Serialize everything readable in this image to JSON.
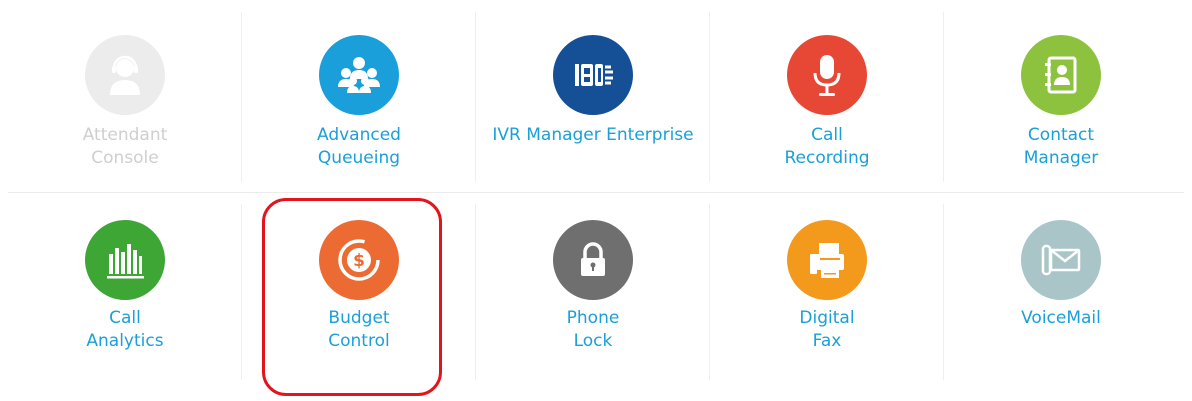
{
  "row1": [
    {
      "line1": "Attendant",
      "line2": "Console",
      "icon": "headset-user-icon",
      "color": "#ececec",
      "disabled": true
    },
    {
      "line1": "Advanced",
      "line2": "Queueing",
      "icon": "queue-people-icon",
      "color": "#1a9fdb"
    },
    {
      "line1": "IVR Manager Enterprise",
      "line2": "",
      "icon": "ivr-icon",
      "color": "#154f96"
    },
    {
      "line1": "Call",
      "line2": "Recording",
      "icon": "microphone-icon",
      "color": "#e64835"
    },
    {
      "line1": "Contact",
      "line2": "Manager",
      "icon": "contact-book-icon",
      "color": "#8dc23f"
    }
  ],
  "row2": [
    {
      "line1": "Call",
      "line2": "Analytics",
      "icon": "bar-chart-icon",
      "color": "#3ea635"
    },
    {
      "line1": "Budget",
      "line2": "Control",
      "icon": "dollar-icon",
      "color": "#ec6b33"
    },
    {
      "line1": "Phone",
      "line2": "Lock",
      "icon": "padlock-icon",
      "color": "#6f6f6f"
    },
    {
      "line1": "Digital",
      "line2": "Fax",
      "icon": "fax-icon",
      "color": "#f39a1c"
    },
    {
      "line1": "VoiceMail",
      "line2": "",
      "icon": "voicemail-icon",
      "color": "#a9c5c8"
    }
  ]
}
